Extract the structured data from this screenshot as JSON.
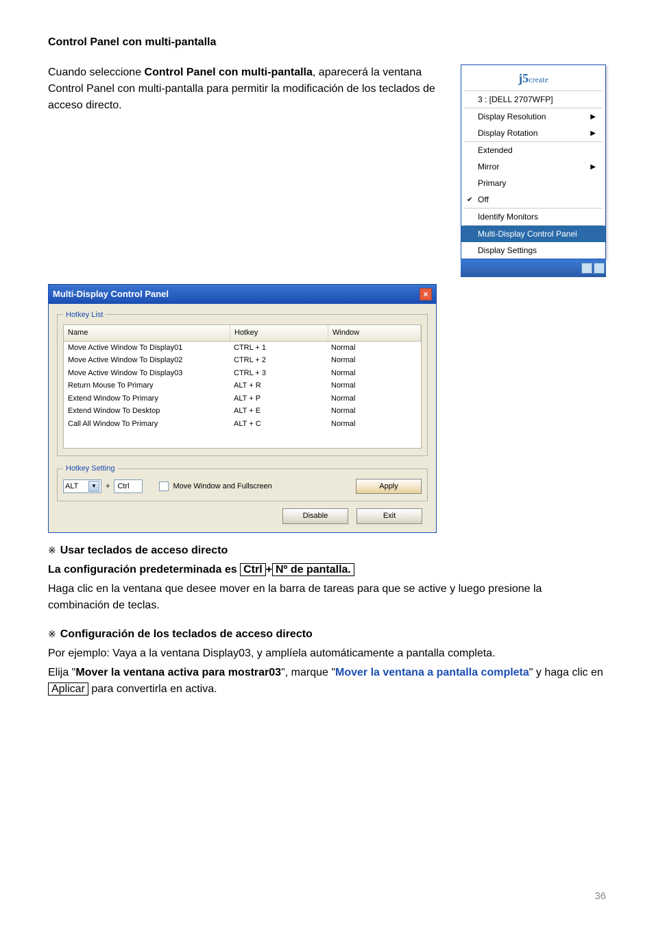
{
  "title": "Control Panel con multi-pantalla",
  "intro": {
    "line1_a": "Cuando seleccione ",
    "line1_b": "Control Panel con multi-pantalla",
    "line2": ", aparecerá la ventana Control Panel con multi-pantalla para permitir la modificación de los teclados de acceso directo."
  },
  "menu": {
    "logo_i": "j",
    "logo_5": "5",
    "logo_rest": "create",
    "display": "3 : [DELL 2707WFP]",
    "resolution": "Display Resolution",
    "rotation": "Display Rotation",
    "extended": "Extended",
    "mirror": "Mirror",
    "primary": "Primary",
    "off": "Off",
    "identify": "Identify Monitors",
    "mdcp": "Multi-Display Control Panel",
    "settings": "Display Settings"
  },
  "dialog": {
    "title": "Multi-Display Control Panel",
    "fieldset1": "Hotkey List",
    "col_name": "Name",
    "col_hotkey": "Hotkey",
    "col_window": "Window",
    "rows": [
      {
        "name": "Move Active Window To Display01",
        "hotkey": "CTRL + 1",
        "window": "Normal"
      },
      {
        "name": "Move Active Window To Display02",
        "hotkey": "CTRL + 2",
        "window": "Normal"
      },
      {
        "name": "Move Active Window To Display03",
        "hotkey": "CTRL + 3",
        "window": "Normal"
      },
      {
        "name": "Return Mouse To Primary",
        "hotkey": "ALT + R",
        "window": "Normal"
      },
      {
        "name": "Extend Window To Primary",
        "hotkey": "ALT + P",
        "window": "Normal"
      },
      {
        "name": "Extend Window To Desktop",
        "hotkey": "ALT + E",
        "window": "Normal"
      },
      {
        "name": "Call All Window To Primary",
        "hotkey": "ALT + C",
        "window": "Normal"
      }
    ],
    "fieldset2": "Hotkey Setting",
    "mod": "ALT",
    "plus": "+",
    "key": "Ctrl",
    "chk_label": "Move Window and Fullscreen",
    "apply": "Apply",
    "disable": "Disable",
    "exit": "Exit"
  },
  "sec1": {
    "h": "Usar teclados de acceso directo",
    "p1_a": "La configuración predeterminada es",
    "p1_b": "Ctrl",
    "p1_plus": "+",
    "p1_c": "Nº de pantalla.",
    "p2": "Haga clic en la ventana que desee mover en la barra de tareas para que se active y luego presione la combinación de teclas."
  },
  "sec2": {
    "h": "Configuración de los teclados de acceso directo",
    "p1": "Por ejemplo: Vaya a la ventana Display03, y amplíela automáticamente a pantalla completa.",
    "p2_a": "Elija \"",
    "p2_b": "Mover la ventana activa para mostrar03",
    "p2_c": "\", marque \"",
    "p2_d": "Mover la ventana a pantalla completa",
    "p2_e": "\" y haga clic en",
    "p2_f": "Aplicar",
    "p2_g": " para convertirla en activa."
  },
  "page_number": "36"
}
